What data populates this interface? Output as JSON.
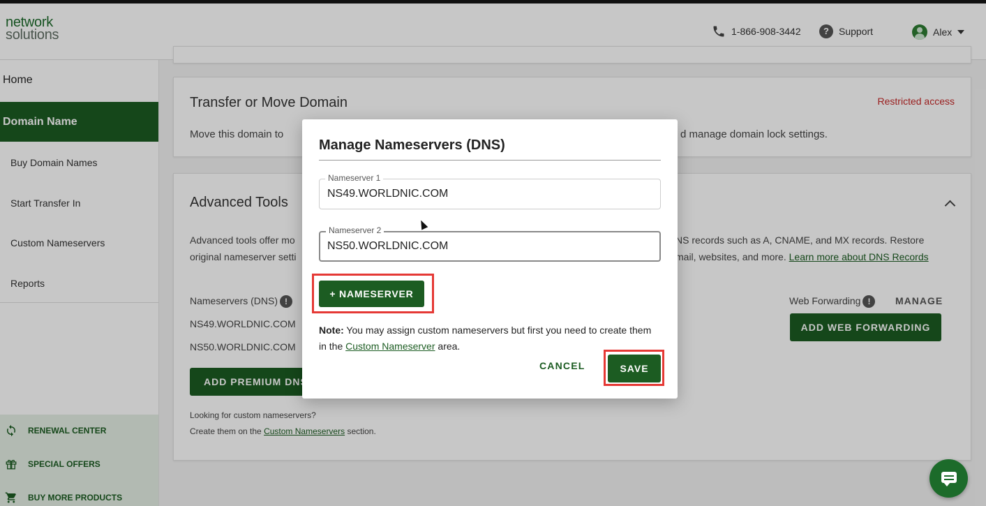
{
  "header": {
    "logo_line1": "network",
    "logo_line2": "solutions",
    "phone": "1-866-908-3442",
    "support": "Support",
    "user": "Alex"
  },
  "sidebar": {
    "home": "Home",
    "section": "Domain Name",
    "items": [
      {
        "label": "Buy Domain Names"
      },
      {
        "label": "Start Transfer In"
      },
      {
        "label": "Custom Nameservers"
      },
      {
        "label": "Reports"
      }
    ],
    "bottom_links": [
      {
        "label": "RENEWAL CENTER",
        "icon": "refresh-icon"
      },
      {
        "label": "SPECIAL OFFERS",
        "icon": "gift-icon"
      },
      {
        "label": "BUY MORE PRODUCTS",
        "icon": "cart-icon"
      }
    ]
  },
  "transfer_card": {
    "title": "Transfer or Move Domain",
    "restricted": "Restricted access",
    "desc_left": "Move this domain to",
    "desc_right": "d manage domain lock settings."
  },
  "advanced_card": {
    "title": "Advanced Tools",
    "desc_l1_left": "Advanced tools offer mo",
    "desc_l1_right": "NS records such as A, CNAME, and MX records. Restore",
    "desc_l2_left": "original nameserver setti",
    "desc_l2_right": "mail, websites, and more.",
    "desc_link": "Learn more about DNS Records",
    "ns_label": "Nameservers (DNS)",
    "ns1": "NS49.WORLDNIC.COM",
    "ns2": "NS50.WORLDNIC.COM",
    "add_premium": "ADD PREMIUM DNS",
    "looking": "Looking for custom nameservers?",
    "create_prefix": "Create them on the",
    "create_link": "Custom Nameservers",
    "create_suffix": "section.",
    "webfwd_label": "Web Forwarding",
    "manage": "MANAGE",
    "add_webfwd": "ADD WEB FORWARDING"
  },
  "modal": {
    "title": "Manage Nameservers (DNS)",
    "ns1_label": "Nameserver 1",
    "ns1_value": "NS49.WORLDNIC.COM",
    "ns2_label": "Nameserver 2",
    "ns2_value": "NS50.WORLDNIC.COM",
    "add_button": "+ NAMESERVER",
    "note_bold": "Note:",
    "note_text": "You may assign custom nameservers but first you need to create them in the",
    "note_link": "Custom Nameserver",
    "note_suffix": "area.",
    "cancel": "CANCEL",
    "save": "SAVE"
  },
  "colors": {
    "brand_green": "#1c5c22",
    "highlight_red": "#e53935",
    "restricted_red": "#c62828"
  }
}
